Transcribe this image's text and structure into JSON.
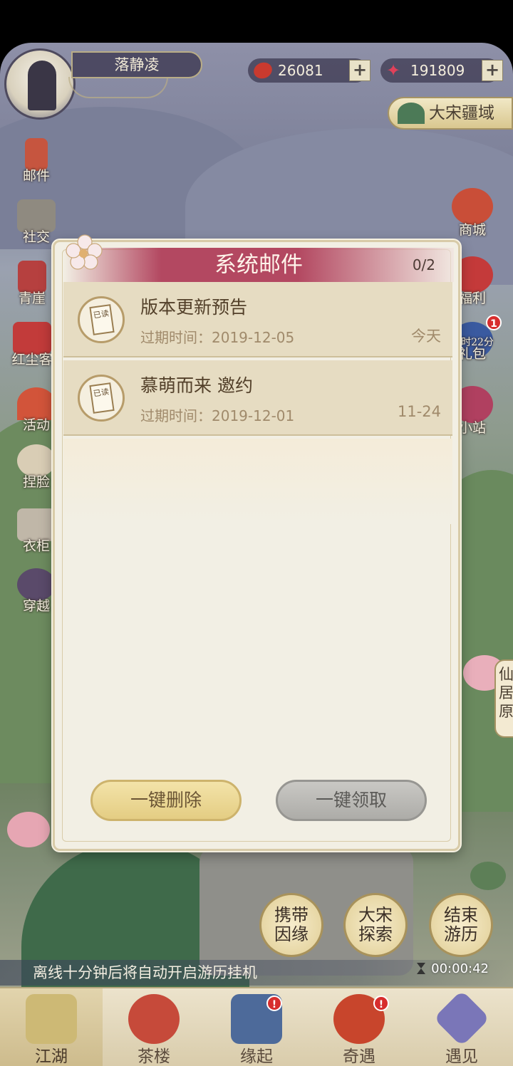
{
  "header": {
    "player_name": "落静凌",
    "currency_a": "26081",
    "currency_b": "191809",
    "plus": "+",
    "region": "大宋疆域"
  },
  "left_menu": [
    {
      "label": "邮件",
      "icon": "mail-icon"
    },
    {
      "label": "社交",
      "icon": "social-icon"
    },
    {
      "label": "青崖",
      "icon": "scroll-icon"
    },
    {
      "label": "红尘客",
      "icon": "pavilion-icon"
    },
    {
      "label": "活动",
      "icon": "fan-icon"
    },
    {
      "label": "捏脸",
      "icon": "face-icon"
    },
    {
      "label": "衣柜",
      "icon": "wardrobe-icon"
    },
    {
      "label": "穿越",
      "icon": "portal-icon"
    }
  ],
  "right_menu": [
    {
      "label": "商城",
      "icon": "shop-icon"
    },
    {
      "label": "福利",
      "icon": "gift-icon"
    },
    {
      "label": "礼包",
      "icon": "package-icon",
      "extra": "八时22分"
    },
    {
      "label": "小站",
      "icon": "station-icon"
    }
  ],
  "dialog": {
    "title": "系统邮件",
    "count": "0/2",
    "read_tag": "已读",
    "mails": [
      {
        "subject": "版本更新预告",
        "expiry": "过期时间：2019-12-05",
        "date": "今天"
      },
      {
        "subject": "慕萌而来 邀约",
        "expiry": "过期时间：2019-12-01",
        "date": "11-24"
      }
    ],
    "delete_all": "一键删除",
    "claim_all": "一键领取"
  },
  "map_actions": [
    {
      "label": "携带\n因缘"
    },
    {
      "label": "大宋\n探索"
    },
    {
      "label": "结束\n游历"
    }
  ],
  "status": {
    "auto_note": "离线十分钟后将自动开启游历挂机",
    "timer": "00:00:42"
  },
  "bottom_nav": [
    {
      "label": "江湖",
      "active": true
    },
    {
      "label": "茶楼",
      "active": false
    },
    {
      "label": "缘起",
      "active": false,
      "badge": "!"
    },
    {
      "label": "奇遇",
      "active": false,
      "badge": "!"
    },
    {
      "label": "遇见",
      "active": false
    }
  ],
  "side_right_label": "仙居原",
  "colors": {
    "dialog_header": "#b34861",
    "delete_button": "#e4cd83",
    "claim_button": "#adaca8",
    "badge": "#d72d2d"
  }
}
